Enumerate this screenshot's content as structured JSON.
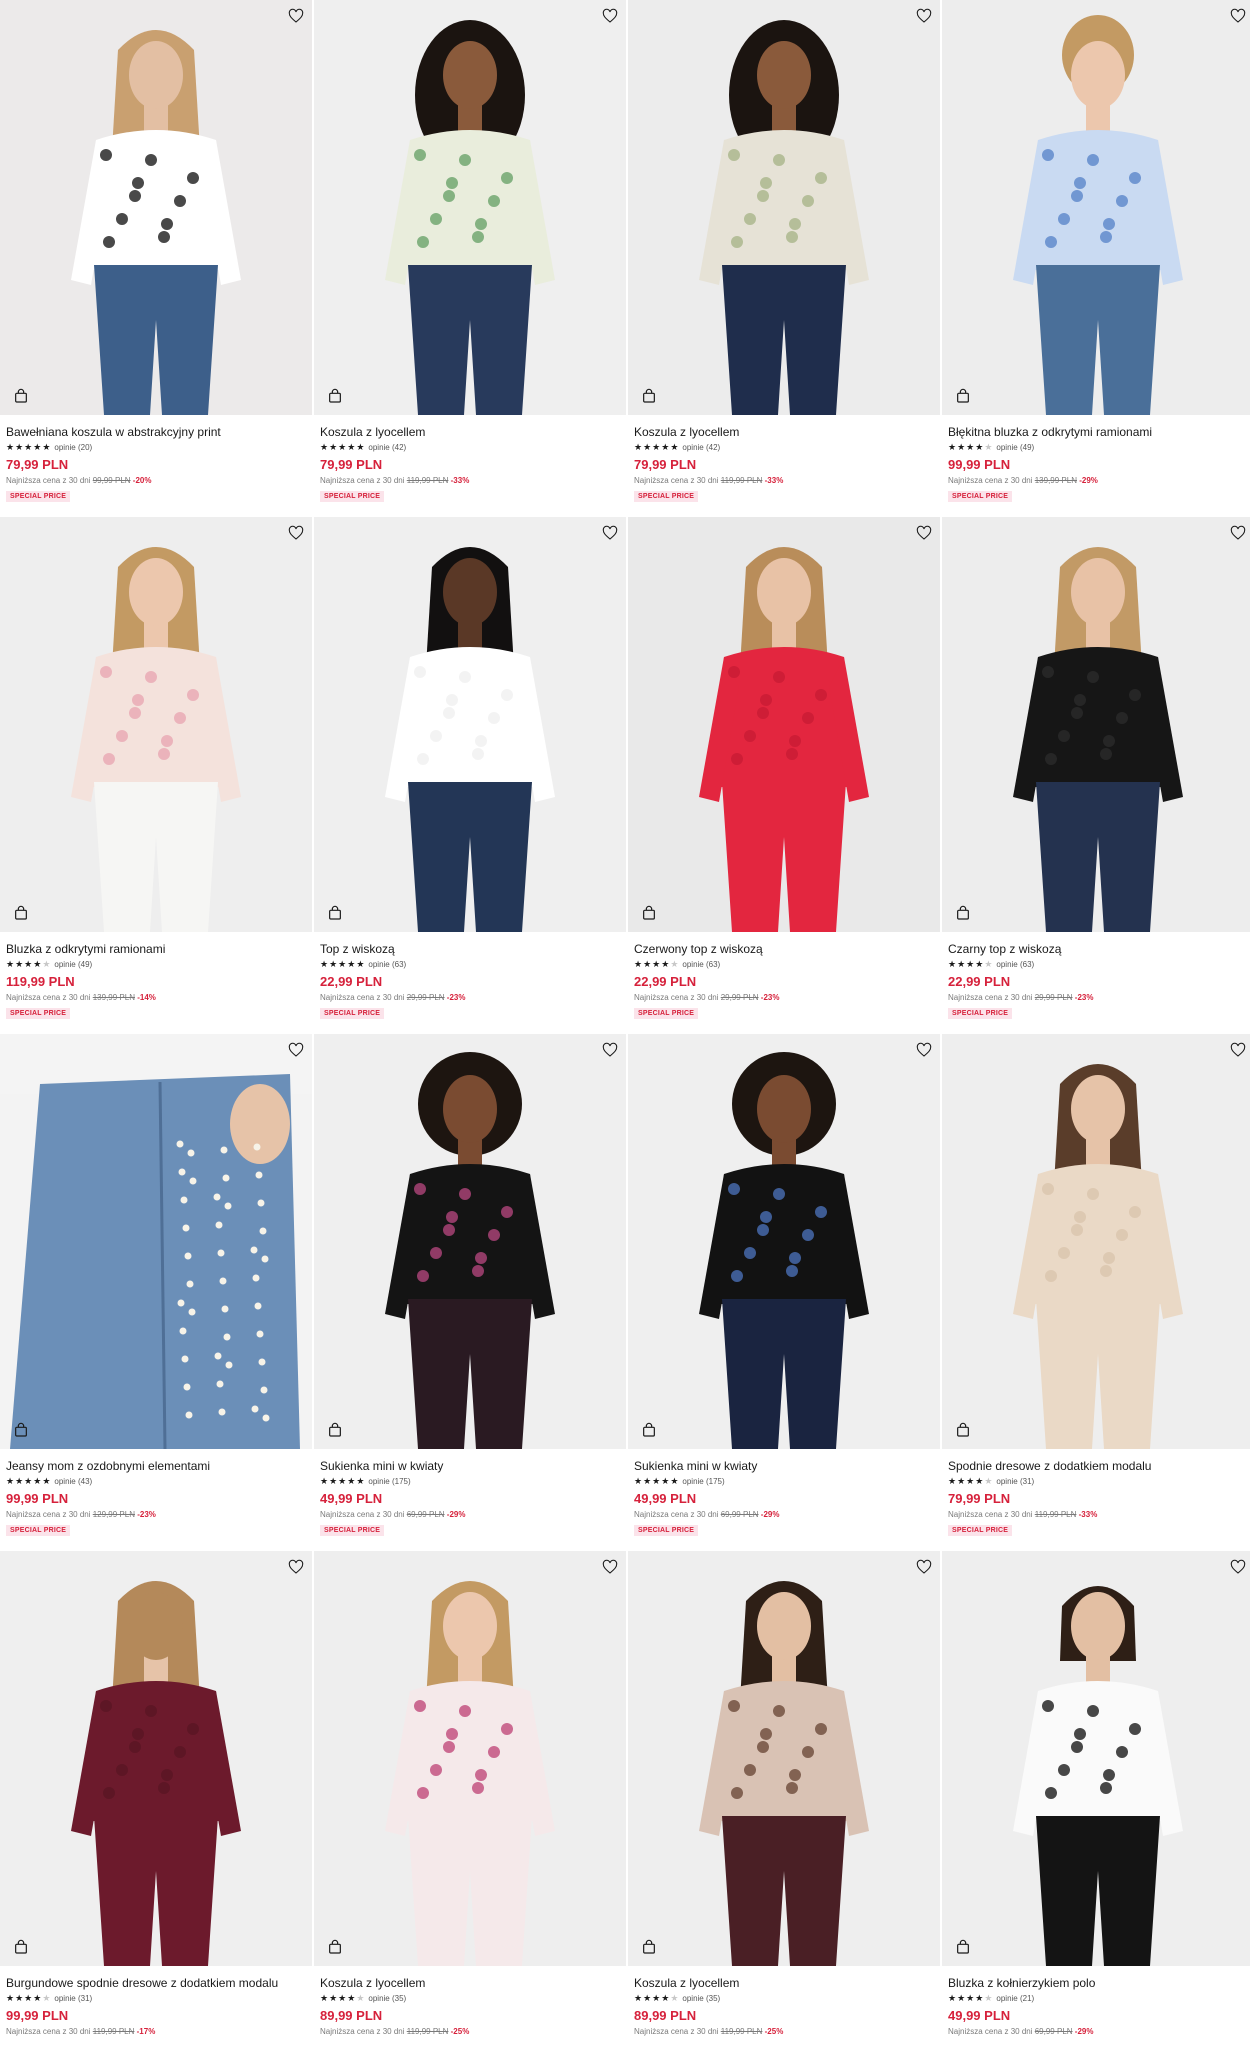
{
  "colors": {
    "price": "#d6213b",
    "badge_bg": "#fbe3ea",
    "text": "#1a1a1a"
  },
  "icons": {
    "wishlist": "heart-icon",
    "cart": "shopping-bag-icon"
  },
  "lowest_label": "Najniższa cena z 30 dni",
  "products": [
    {
      "name": "Bawełniana koszula w abstrakcyjny print",
      "rating": 5,
      "reviews": "opinie (20)",
      "price": "79,99 PLN",
      "old_price": "99,99 PLN",
      "discount": "-20%",
      "badge": "SPECIAL PRICE",
      "bg": "#eceaea",
      "skin": "#e3bfa3",
      "hair": "#c9a070",
      "top": "#ffffff",
      "accent": "#1c1c1c",
      "bottom": "#3d5f8a",
      "hairstyle": "long"
    },
    {
      "name": "Koszula z lyocellem",
      "rating": 5,
      "reviews": "opinie (42)",
      "price": "79,99 PLN",
      "old_price": "119,99 PLN",
      "discount": "-33%",
      "badge": "SPECIAL PRICE",
      "bg": "#efefef",
      "skin": "#8a5a3b",
      "hair": "#1b1410",
      "top": "#e9eddc",
      "accent": "#6aa36a",
      "bottom": "#283a5c",
      "hairstyle": "curly"
    },
    {
      "name": "Koszula z lyocellem",
      "rating": 5,
      "reviews": "opinie (42)",
      "price": "79,99 PLN",
      "old_price": "119,99 PLN",
      "discount": "-33%",
      "badge": "SPECIAL PRICE",
      "bg": "#ececec",
      "skin": "#8a5a3b",
      "hair": "#1b1410",
      "top": "#e6e2d6",
      "accent": "#a9b58a",
      "bottom": "#1f2d4c",
      "hairstyle": "curly"
    },
    {
      "name": "Błękitna bluzka z odkrytymi ramionami",
      "rating": 4.5,
      "reviews": "opinie (49)",
      "price": "99,99 PLN",
      "old_price": "139,99 PLN",
      "discount": "-29%",
      "badge": "SPECIAL PRICE",
      "bg": "#ededed",
      "skin": "#ecc7ad",
      "hair": "#c39a63",
      "top": "#c9daf2",
      "accent": "#5b86c9",
      "bottom": "#4a6f99",
      "hairstyle": "bun"
    },
    {
      "name": "Bluzka z odkrytymi ramionami",
      "rating": 4.5,
      "reviews": "opinie (49)",
      "price": "119,99 PLN",
      "old_price": "139,99 PLN",
      "discount": "-14%",
      "badge": "SPECIAL PRICE",
      "bg": "#eeeeee",
      "skin": "#ecc7ad",
      "hair": "#c39a63",
      "top": "#f4e2dc",
      "accent": "#e9a7b3",
      "bottom": "#f6f6f4",
      "hairstyle": "long"
    },
    {
      "name": "Top z wiskozą",
      "rating": 5,
      "reviews": "opinie (63)",
      "price": "22,99 PLN",
      "old_price": "29,99 PLN",
      "discount": "-23%",
      "badge": "SPECIAL PRICE",
      "bg": "#efefef",
      "skin": "#5a3826",
      "hair": "#121010",
      "top": "#ffffff",
      "accent": "#f0f0f0",
      "bottom": "#233656",
      "hairstyle": "long"
    },
    {
      "name": "Czerwony top z wiskozą",
      "rating": 4.5,
      "reviews": "opinie (63)",
      "price": "22,99 PLN",
      "old_price": "29,99 PLN",
      "discount": "-23%",
      "badge": "SPECIAL PRICE",
      "bg": "#e9e9e9",
      "skin": "#e8c2a6",
      "hair": "#b98d5a",
      "top": "#e3263f",
      "accent": "#c81c34",
      "bottom": "#e3263f",
      "hairstyle": "long"
    },
    {
      "name": "Czarny top z wiskozą",
      "rating": 4.5,
      "reviews": "opinie (63)",
      "price": "22,99 PLN",
      "old_price": "29,99 PLN",
      "discount": "-23%",
      "badge": "SPECIAL PRICE",
      "bg": "#ededed",
      "skin": "#e8c2a6",
      "hair": "#c29a66",
      "top": "#161616",
      "accent": "#2a2a2a",
      "bottom": "#24324f",
      "hairstyle": "long"
    },
    {
      "name": "Jeansy mom z ozdobnymi elementami",
      "rating": 5,
      "reviews": "opinie (43)",
      "price": "99,99 PLN",
      "old_price": "129,99 PLN",
      "discount": "-23%",
      "badge": "SPECIAL PRICE",
      "bg": "#f3f3f3",
      "skin": "#e6c3a8",
      "hair": "#c39a63",
      "top": "#f4f4f4",
      "accent": "#f7f3e8",
      "bottom": "#6b8fb8",
      "hairstyle": "none"
    },
    {
      "name": "Sukienka mini w kwiaty",
      "rating": 5,
      "reviews": "opinie (175)",
      "price": "49,99 PLN",
      "old_price": "69,99 PLN",
      "discount": "-29%",
      "badge": "SPECIAL PRICE",
      "bg": "#efefef",
      "skin": "#7a4b31",
      "hair": "#1d1510",
      "top": "#141414",
      "accent": "#b0457a",
      "bottom": "#2a1a22",
      "hairstyle": "afro"
    },
    {
      "name": "Sukienka mini w kwiaty",
      "rating": 5,
      "reviews": "opinie (175)",
      "price": "49,99 PLN",
      "old_price": "69,99 PLN",
      "discount": "-29%",
      "badge": "SPECIAL PRICE",
      "bg": "#efefef",
      "skin": "#7a4b31",
      "hair": "#1d1510",
      "top": "#121212",
      "accent": "#4a6fb5",
      "bottom": "#1a2440",
      "hairstyle": "afro"
    },
    {
      "name": "Spodnie dresowe z dodatkiem modalu",
      "rating": 4.5,
      "reviews": "opinie (31)",
      "price": "79,99 PLN",
      "old_price": "119,99 PLN",
      "discount": "-33%",
      "badge": "SPECIAL PRICE",
      "bg": "#eeeeee",
      "skin": "#e6c3a8",
      "hair": "#5a3d2a",
      "top": "#ead9c6",
      "accent": "#d9c4ad",
      "bottom": "#ead9c6",
      "hairstyle": "long"
    },
    {
      "name": "Burgundowe spodnie dresowe z dodatkiem modalu",
      "rating": 4.5,
      "reviews": "opinie (31)",
      "price": "99,99 PLN",
      "old_price": "119,99 PLN",
      "discount": "-17%",
      "badge": "",
      "bg": "#efefef",
      "skin": "#e6c3a8",
      "hair": "#b4895a",
      "top": "#6c1a2c",
      "accent": "#5a1524",
      "bottom": "#6c1a2c",
      "hairstyle": "back"
    },
    {
      "name": "Koszula z lyocellem",
      "rating": 4.5,
      "reviews": "opinie (35)",
      "price": "89,99 PLN",
      "old_price": "119,99 PLN",
      "discount": "-25%",
      "badge": "",
      "bg": "#eeeeee",
      "skin": "#ecc7ad",
      "hair": "#c39a63",
      "top": "#f5e9ea",
      "accent": "#c04a7a",
      "bottom": "#f5e9ea",
      "hairstyle": "long"
    },
    {
      "name": "Koszula z lyocellem",
      "rating": 4.5,
      "reviews": "opinie (35)",
      "price": "89,99 PLN",
      "old_price": "119,99 PLN",
      "discount": "-25%",
      "badge": "",
      "bg": "#eeeeee",
      "skin": "#e3bfa3",
      "hair": "#2e1f16",
      "top": "#d9c2b4",
      "accent": "#6b4a3a",
      "bottom": "#4a1f25",
      "hairstyle": "long"
    },
    {
      "name": "Bluzka z kołnierzykiem polo",
      "rating": 4.5,
      "reviews": "opinie (21)",
      "price": "49,99 PLN",
      "old_price": "69,99 PLN",
      "discount": "-29%",
      "badge": "",
      "bg": "#eeeeee",
      "skin": "#e3bfa3",
      "hair": "#2e1f16",
      "top": "#fafafa",
      "accent": "#1a1a1a",
      "bottom": "#141414",
      "hairstyle": "bob"
    }
  ]
}
